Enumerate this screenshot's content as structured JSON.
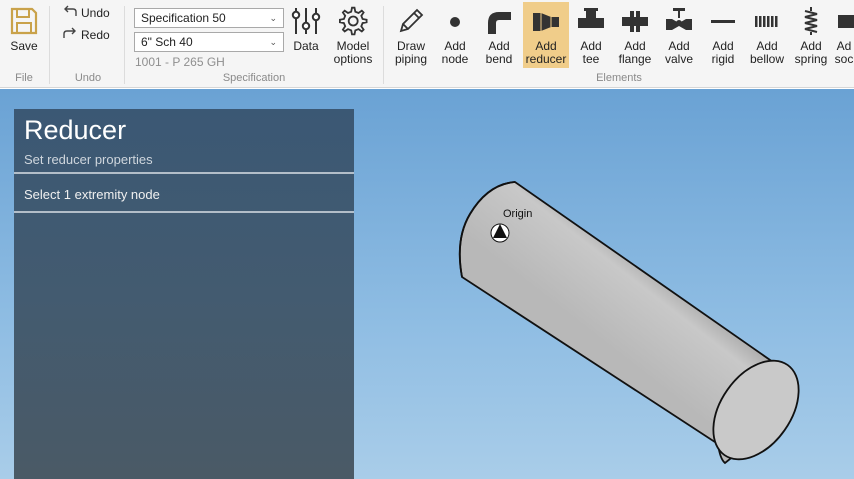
{
  "ribbon": {
    "file": {
      "label": "File",
      "save_label": "Save"
    },
    "undo": {
      "label": "Undo",
      "undo_label": "Undo",
      "redo_label": "Redo"
    },
    "specification": {
      "label": "Specification",
      "spec_value": "Specification 50",
      "size_value": "6\" Sch 40",
      "material": "1001 - P 265 GH",
      "data_label": "Data",
      "model_options_label_1": "Model",
      "model_options_label_2": "options"
    },
    "elements": {
      "label": "Elements",
      "buttons": [
        {
          "l1": "Draw",
          "l2": "piping",
          "icon": "pencil-icon"
        },
        {
          "l1": "Add",
          "l2": "node",
          "icon": "node-dot-icon"
        },
        {
          "l1": "Add",
          "l2": "bend",
          "icon": "bend-pipe-icon"
        },
        {
          "l1": "Add",
          "l2": "reducer",
          "icon": "reducer-icon"
        },
        {
          "l1": "Add",
          "l2": "tee",
          "icon": "tee-icon"
        },
        {
          "l1": "Add",
          "l2": "flange",
          "icon": "flange-icon"
        },
        {
          "l1": "Add",
          "l2": "valve",
          "icon": "valve-icon"
        },
        {
          "l1": "Add",
          "l2": "rigid",
          "icon": "rigid-icon"
        },
        {
          "l1": "Add",
          "l2": "bellow",
          "icon": "bellow-icon"
        },
        {
          "l1": "Add",
          "l2": "spring",
          "icon": "spring-icon"
        },
        {
          "l1": "Ad",
          "l2": "soc",
          "icon": "socket-icon"
        }
      ]
    }
  },
  "panel": {
    "title": "Reducer",
    "subtitle": "Set reducer properties",
    "step": "Select 1 extremity node"
  },
  "viewport": {
    "origin_label": "Origin"
  },
  "colors": {
    "active_button": "#f0cd8a",
    "ribbon_bg": "#f5f5f5",
    "panel_top": "#3b5874",
    "sky_top": "#6aa2d4"
  }
}
